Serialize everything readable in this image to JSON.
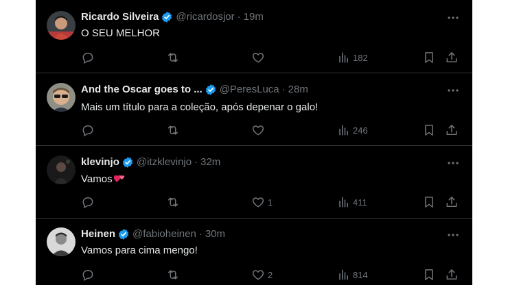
{
  "tweets": [
    {
      "name": "Ricardo Silveira",
      "handle": "@ricardosjor",
      "time": "19m",
      "text": "O SEU MELHOR",
      "replies": "",
      "retweets": "",
      "likes": "",
      "views": "182",
      "avatar": "young-man-avatar"
    },
    {
      "name": "And the Oscar goes to ...",
      "handle": "@PeresLuca",
      "time": "28m",
      "text": "Mais um título para a coleção, após depenar o galo!",
      "replies": "",
      "retweets": "",
      "likes": "",
      "views": "246",
      "avatar": "man-sunglasses-avatar"
    },
    {
      "name": "klevinjo",
      "handle": "@itzklevinjo",
      "time": "32m",
      "text": "Vamos",
      "text_emoji": "two-hearts-emoji",
      "replies": "",
      "retweets": "",
      "likes": "1",
      "views": "411",
      "avatar": "dark-photo-avatar"
    },
    {
      "name": "Heinen",
      "handle": "@fabioheinen",
      "time": "30m",
      "text": "Vamos para cima mengo!",
      "replies": "",
      "retweets": "",
      "likes": "2",
      "views": "814",
      "avatar": "bw-portrait-avatar"
    }
  ],
  "colors": {
    "background": "#000000",
    "text": "#e7e9ea",
    "muted": "#71767b",
    "divider": "#2f3336",
    "verified": "#1d9bf0",
    "heart_emoji": "#e0245e"
  }
}
